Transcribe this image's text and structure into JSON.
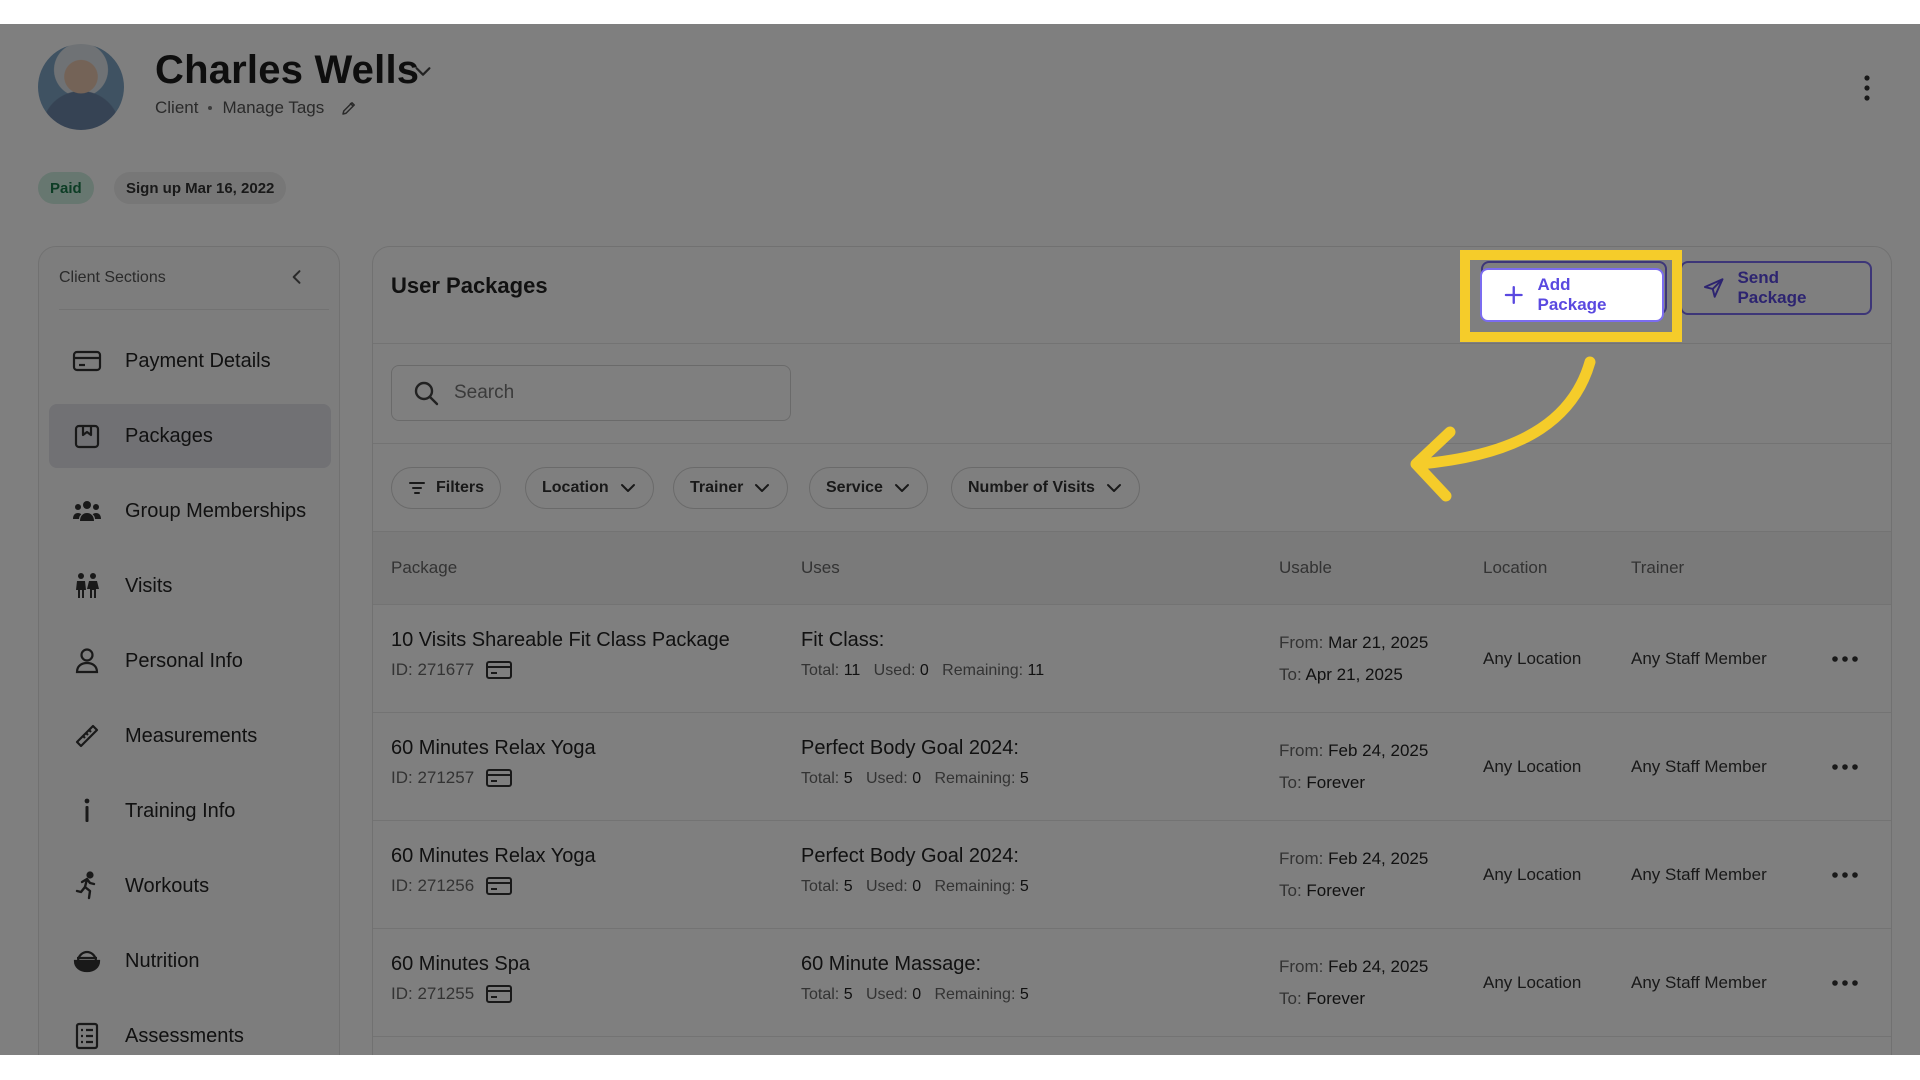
{
  "client": {
    "name": "Charles Wells",
    "role": "Client",
    "manage_tags": "Manage Tags",
    "badge_paid": "Paid",
    "badge_signup": "Sign up Mar 16, 2022"
  },
  "sidebar": {
    "title": "Client Sections",
    "items": [
      {
        "label": "Payment Details",
        "icon": "credit-card-icon"
      },
      {
        "label": "Packages",
        "icon": "package-icon",
        "active": true
      },
      {
        "label": "Group Memberships",
        "icon": "group-icon"
      },
      {
        "label": "Visits",
        "icon": "visits-icon"
      },
      {
        "label": "Personal Info",
        "icon": "person-icon"
      },
      {
        "label": "Measurements",
        "icon": "ruler-icon"
      },
      {
        "label": "Training Info",
        "icon": "info-icon"
      },
      {
        "label": "Workouts",
        "icon": "running-icon"
      },
      {
        "label": "Nutrition",
        "icon": "bowl-icon"
      },
      {
        "label": "Assessments",
        "icon": "clipboard-icon"
      }
    ]
  },
  "main": {
    "title": "User Packages",
    "add_package": "Add Package",
    "send_package": "Send Package",
    "search_placeholder": "Search",
    "filters": [
      "Filters",
      "Location",
      "Trainer",
      "Service",
      "Number of Visits"
    ],
    "columns": [
      "Package",
      "Uses",
      "Usable",
      "Location",
      "Trainer"
    ],
    "labels": {
      "total": "Total:",
      "used": "Used:",
      "remaining": "Remaining:",
      "from": "From:",
      "to": "To:"
    },
    "rows": [
      {
        "name": "10 Visits Shareable Fit Class Package",
        "id": "ID: 271677",
        "service": "Fit Class:",
        "total": "11",
        "used": "0",
        "remaining": "11",
        "from": "Mar 21, 2025",
        "to": "Apr 21, 2025",
        "location": "Any Location",
        "trainer": "Any Staff Member"
      },
      {
        "name": "60 Minutes Relax Yoga",
        "id": "ID: 271257",
        "service": "Perfect Body Goal 2024:",
        "total": "5",
        "used": "0",
        "remaining": "5",
        "from": "Feb 24, 2025",
        "to": "Forever",
        "location": "Any Location",
        "trainer": "Any Staff Member"
      },
      {
        "name": "60 Minutes Relax Yoga",
        "id": "ID: 271256",
        "service": "Perfect Body Goal 2024:",
        "total": "5",
        "used": "0",
        "remaining": "5",
        "from": "Feb 24, 2025",
        "to": "Forever",
        "location": "Any Location",
        "trainer": "Any Staff Member"
      },
      {
        "name": "60 Minutes Spa",
        "id": "ID: 271255",
        "service": "60 Minute Massage:",
        "total": "5",
        "used": "0",
        "remaining": "5",
        "from": "Feb 24, 2025",
        "to": "Forever",
        "location": "Any Location",
        "trainer": "Any Staff Member"
      }
    ]
  },
  "colors": {
    "accent": "#5a49e0",
    "highlight": "#f5cc2a",
    "paid_bg": "#cfeee0",
    "paid_text": "#1b7a4a"
  }
}
